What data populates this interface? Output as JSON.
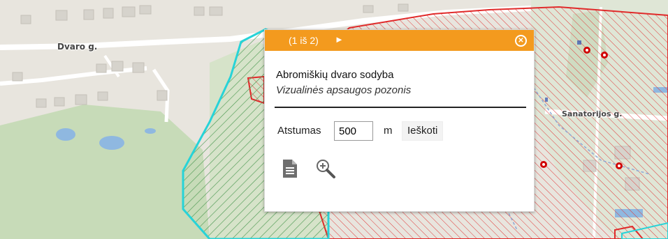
{
  "map": {
    "street_labels": [
      "Dvaro g.",
      "Sanatorijos g."
    ]
  },
  "popup": {
    "counter": "(1 iš 2)",
    "next_icon": "►",
    "close_icon": "close-circle-icon",
    "feature_title": "Abromiškių dvaro sodyba",
    "feature_subtitle": "Vizualinės apsaugos pozonis",
    "distance_label": "Atstumas",
    "distance_value": "500",
    "distance_unit": "m",
    "search_label": "Ieškoti",
    "tools": [
      "document-icon",
      "zoom-in-icon"
    ]
  },
  "colors": {
    "header": "#f39a1e",
    "zone_cyan": "#27d3d8",
    "zone_red": "#e02a2a",
    "zone_green_hatch": "#4f9a54"
  }
}
